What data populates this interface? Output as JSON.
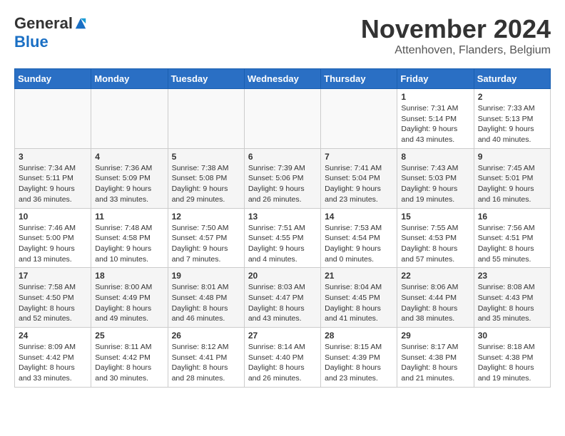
{
  "header": {
    "logo_general": "General",
    "logo_blue": "Blue",
    "month_title": "November 2024",
    "location": "Attenhoven, Flanders, Belgium"
  },
  "days_of_week": [
    "Sunday",
    "Monday",
    "Tuesday",
    "Wednesday",
    "Thursday",
    "Friday",
    "Saturday"
  ],
  "weeks": [
    [
      {
        "day": "",
        "info": ""
      },
      {
        "day": "",
        "info": ""
      },
      {
        "day": "",
        "info": ""
      },
      {
        "day": "",
        "info": ""
      },
      {
        "day": "",
        "info": ""
      },
      {
        "day": "1",
        "info": "Sunrise: 7:31 AM\nSunset: 5:14 PM\nDaylight: 9 hours and 43 minutes."
      },
      {
        "day": "2",
        "info": "Sunrise: 7:33 AM\nSunset: 5:13 PM\nDaylight: 9 hours and 40 minutes."
      }
    ],
    [
      {
        "day": "3",
        "info": "Sunrise: 7:34 AM\nSunset: 5:11 PM\nDaylight: 9 hours and 36 minutes."
      },
      {
        "day": "4",
        "info": "Sunrise: 7:36 AM\nSunset: 5:09 PM\nDaylight: 9 hours and 33 minutes."
      },
      {
        "day": "5",
        "info": "Sunrise: 7:38 AM\nSunset: 5:08 PM\nDaylight: 9 hours and 29 minutes."
      },
      {
        "day": "6",
        "info": "Sunrise: 7:39 AM\nSunset: 5:06 PM\nDaylight: 9 hours and 26 minutes."
      },
      {
        "day": "7",
        "info": "Sunrise: 7:41 AM\nSunset: 5:04 PM\nDaylight: 9 hours and 23 minutes."
      },
      {
        "day": "8",
        "info": "Sunrise: 7:43 AM\nSunset: 5:03 PM\nDaylight: 9 hours and 19 minutes."
      },
      {
        "day": "9",
        "info": "Sunrise: 7:45 AM\nSunset: 5:01 PM\nDaylight: 9 hours and 16 minutes."
      }
    ],
    [
      {
        "day": "10",
        "info": "Sunrise: 7:46 AM\nSunset: 5:00 PM\nDaylight: 9 hours and 13 minutes."
      },
      {
        "day": "11",
        "info": "Sunrise: 7:48 AM\nSunset: 4:58 PM\nDaylight: 9 hours and 10 minutes."
      },
      {
        "day": "12",
        "info": "Sunrise: 7:50 AM\nSunset: 4:57 PM\nDaylight: 9 hours and 7 minutes."
      },
      {
        "day": "13",
        "info": "Sunrise: 7:51 AM\nSunset: 4:55 PM\nDaylight: 9 hours and 4 minutes."
      },
      {
        "day": "14",
        "info": "Sunrise: 7:53 AM\nSunset: 4:54 PM\nDaylight: 9 hours and 0 minutes."
      },
      {
        "day": "15",
        "info": "Sunrise: 7:55 AM\nSunset: 4:53 PM\nDaylight: 8 hours and 57 minutes."
      },
      {
        "day": "16",
        "info": "Sunrise: 7:56 AM\nSunset: 4:51 PM\nDaylight: 8 hours and 55 minutes."
      }
    ],
    [
      {
        "day": "17",
        "info": "Sunrise: 7:58 AM\nSunset: 4:50 PM\nDaylight: 8 hours and 52 minutes."
      },
      {
        "day": "18",
        "info": "Sunrise: 8:00 AM\nSunset: 4:49 PM\nDaylight: 8 hours and 49 minutes."
      },
      {
        "day": "19",
        "info": "Sunrise: 8:01 AM\nSunset: 4:48 PM\nDaylight: 8 hours and 46 minutes."
      },
      {
        "day": "20",
        "info": "Sunrise: 8:03 AM\nSunset: 4:47 PM\nDaylight: 8 hours and 43 minutes."
      },
      {
        "day": "21",
        "info": "Sunrise: 8:04 AM\nSunset: 4:45 PM\nDaylight: 8 hours and 41 minutes."
      },
      {
        "day": "22",
        "info": "Sunrise: 8:06 AM\nSunset: 4:44 PM\nDaylight: 8 hours and 38 minutes."
      },
      {
        "day": "23",
        "info": "Sunrise: 8:08 AM\nSunset: 4:43 PM\nDaylight: 8 hours and 35 minutes."
      }
    ],
    [
      {
        "day": "24",
        "info": "Sunrise: 8:09 AM\nSunset: 4:42 PM\nDaylight: 8 hours and 33 minutes."
      },
      {
        "day": "25",
        "info": "Sunrise: 8:11 AM\nSunset: 4:42 PM\nDaylight: 8 hours and 30 minutes."
      },
      {
        "day": "26",
        "info": "Sunrise: 8:12 AM\nSunset: 4:41 PM\nDaylight: 8 hours and 28 minutes."
      },
      {
        "day": "27",
        "info": "Sunrise: 8:14 AM\nSunset: 4:40 PM\nDaylight: 8 hours and 26 minutes."
      },
      {
        "day": "28",
        "info": "Sunrise: 8:15 AM\nSunset: 4:39 PM\nDaylight: 8 hours and 23 minutes."
      },
      {
        "day": "29",
        "info": "Sunrise: 8:17 AM\nSunset: 4:38 PM\nDaylight: 8 hours and 21 minutes."
      },
      {
        "day": "30",
        "info": "Sunrise: 8:18 AM\nSunset: 4:38 PM\nDaylight: 8 hours and 19 minutes."
      }
    ]
  ]
}
